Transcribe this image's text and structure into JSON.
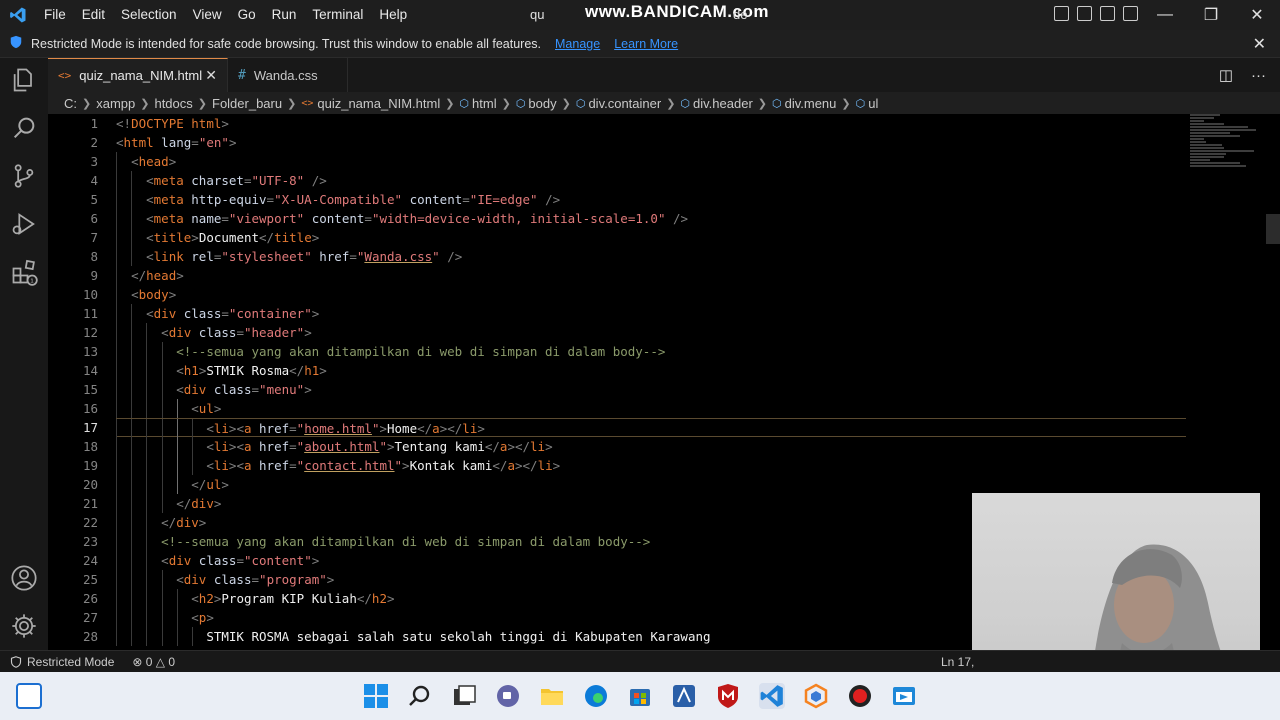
{
  "titlebar": {
    "menu": [
      "File",
      "Edit",
      "Selection",
      "View",
      "Go",
      "Run",
      "Terminal",
      "Help"
    ],
    "title_left": "qu",
    "watermark": "www.BANDICAM.com",
    "title_right": "de",
    "minimize": "—",
    "restore": "❐",
    "close": "✕"
  },
  "banner": {
    "text": "Restricted Mode is intended for safe code browsing. Trust this window to enable all features.",
    "manage": "Manage",
    "learn_more": "Learn More",
    "close": "✕"
  },
  "tabs": [
    {
      "icon": "<>",
      "label": "quiz_nama_NIM.html",
      "close": "✕"
    },
    {
      "icon": "#",
      "label": "Wanda.css"
    }
  ],
  "tab_actions": {
    "split": "◫",
    "more": "···"
  },
  "breadcrumb": {
    "path": [
      "C:",
      "xampp",
      "htdocs",
      "Folder_baru"
    ],
    "file": "quiz_nama_NIM.html",
    "symbols": [
      "html",
      "body",
      "div.container",
      "div.header",
      "div.menu",
      "ul"
    ]
  },
  "editor": {
    "current_line": 17,
    "line_numbers": [
      "1",
      "2",
      "3",
      "4",
      "5",
      "6",
      "7",
      "8",
      "9",
      "10",
      "11",
      "12",
      "13",
      "14",
      "15",
      "16",
      "17",
      "18",
      "19",
      "20",
      "21",
      "22",
      "23",
      "24",
      "25",
      "26",
      "27",
      "28"
    ],
    "lines": [
      "<!DOCTYPE html>",
      "<html lang=\"en\">",
      "  <head>",
      "    <meta charset=\"UTF-8\" />",
      "    <meta http-equiv=\"X-UA-Compatible\" content=\"IE=edge\" />",
      "    <meta name=\"viewport\" content=\"width=device-width, initial-scale=1.0\" />",
      "    <title>Document</title>",
      "    <link rel=\"stylesheet\" href=\"Wanda.css\" />",
      "  </head>",
      "  <body>",
      "    <div class=\"container\">",
      "      <div class=\"header\">",
      "        <!--semua yang akan ditampilkan di web di simpan di dalam body-->",
      "        <h1>STMIK Rosma</h1>",
      "        <div class=\"menu\">",
      "          <ul>",
      "            <li><a href=\"home.html\">Home</a></li>",
      "            <li><a href=\"about.html\">Tentang kami</a></li>",
      "            <li><a href=\"contact.html\">Kontak kami</a></li>",
      "          </ul>",
      "        </div>",
      "      </div>",
      "      <!--semua yang akan ditampilkan di web di simpan di dalam body-->",
      "      <div class=\"content\">",
      "        <div class=\"program\">",
      "          <h2>Program KIP Kuliah</h2>",
      "          <p>",
      "            STMIK ROSMA sebagai salah satu sekolah tinggi di Kabupaten Karawang"
    ]
  },
  "statusbar": {
    "restricted": "Restricted Mode",
    "errors": "⊗ 0 △ 0",
    "position": "Ln 17,"
  },
  "colors": {
    "tag": "#e37933",
    "attr_value": "#e07a7a",
    "comment": "#8a9a6a",
    "link": "#3794ff",
    "accent": "#007acc"
  }
}
